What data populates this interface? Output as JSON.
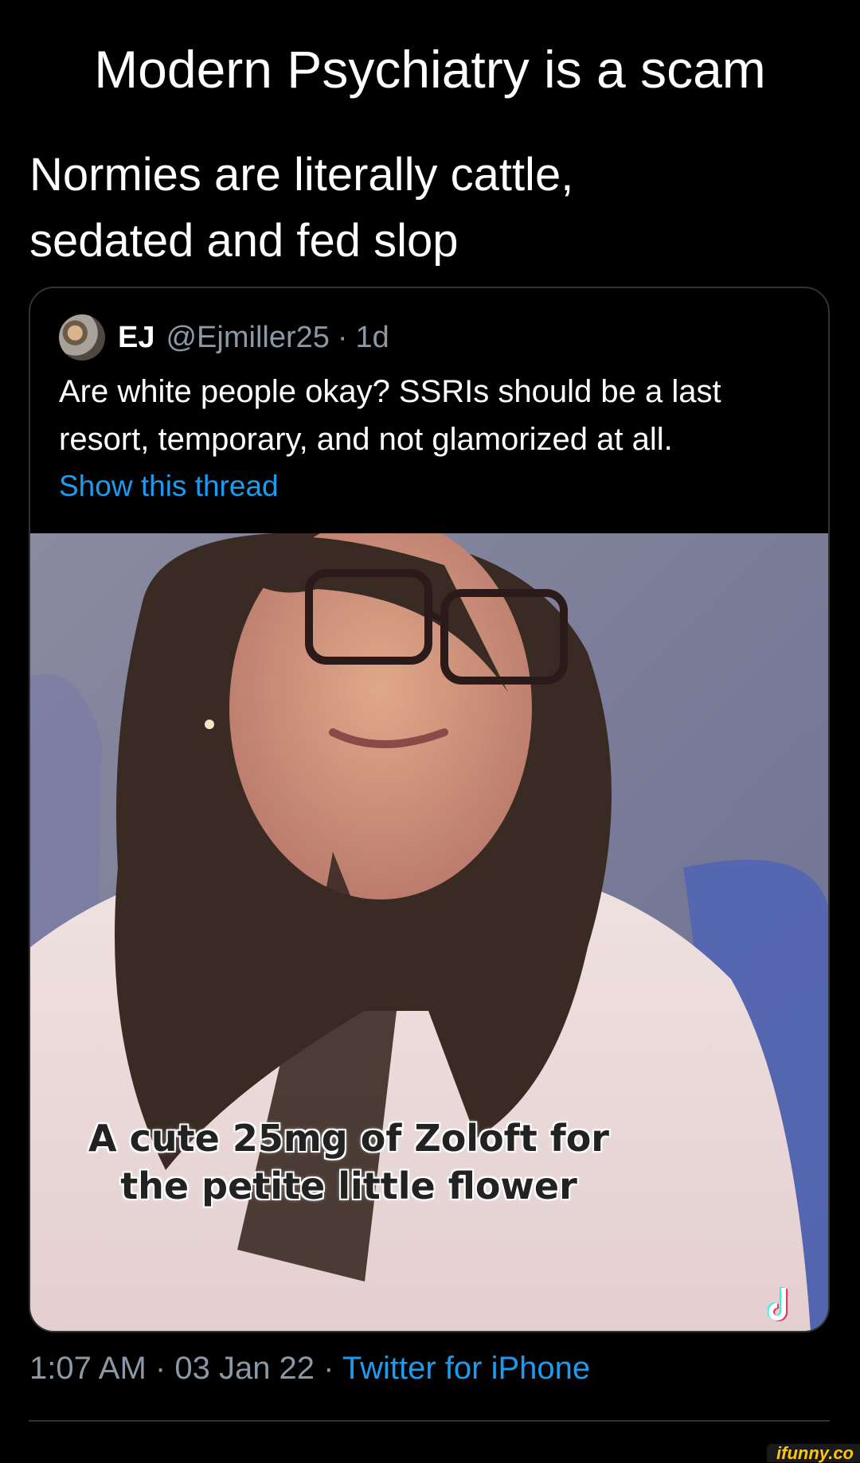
{
  "caption": {
    "title": "Modern Psychiatry is a scam"
  },
  "tweet": {
    "text_lines": [
      "Normies are literally cattle,",
      "sedated and fed slop"
    ],
    "time": "1:07 AM",
    "separator": "·",
    "date": "03 Jan 22",
    "source": "Twitter for iPhone"
  },
  "quoted_tweet": {
    "display_name": "EJ",
    "handle": "@Ejmiller25",
    "separator": "·",
    "age": "1d",
    "text_lines": [
      "Are white people okay? SSRIs should be a last",
      "resort, temporary, and not glamorized at all."
    ],
    "show_thread_label": "Show this thread",
    "media": {
      "caption_lines": [
        "A cute 25mg of Zoloft for",
        "the petite little flower"
      ],
      "icon": "tiktok-logo-icon"
    }
  },
  "watermark": {
    "text": "ifunny.co"
  },
  "colors": {
    "background": "#000000",
    "text": "#ffffff",
    "secondary_text": "#8b98a5",
    "link": "#1d9bf0",
    "border": "#2f3336",
    "watermark": "#ffc40d"
  }
}
